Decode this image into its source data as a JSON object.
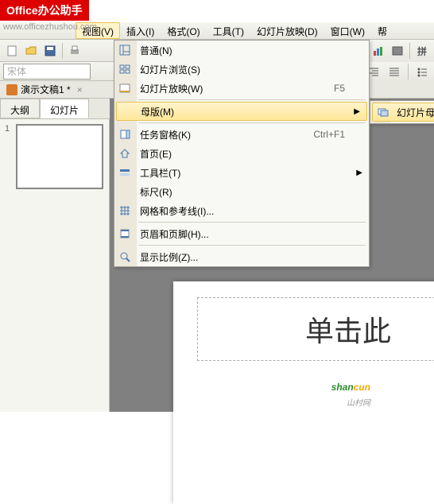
{
  "watermark": {
    "badge": "Office办公助手",
    "url": "www.officezhushou.com",
    "br_shan": "shan",
    "br_cun": "cun",
    "br_sub": "山村网"
  },
  "menubar": {
    "view": "视图(V)",
    "insert": "插入(I)",
    "format": "格式(O)",
    "tools": "工具(T)",
    "slideshow": "幻灯片放映(D)",
    "window": "窗口(W)",
    "help": "帮"
  },
  "toolbar": {
    "font_name": "宋体"
  },
  "doctab": {
    "name": "演示文稿1 *"
  },
  "viewtabs": {
    "outline": "大纲",
    "slides": "幻灯片"
  },
  "thumbnail": {
    "num": "1"
  },
  "dropdown": {
    "normal": "普通(N)",
    "browse": "幻灯片浏览(S)",
    "play": "幻灯片放映(W)",
    "play_key": "F5",
    "master": "母版(M)",
    "taskpane": "任务窗格(K)",
    "taskpane_key": "Ctrl+F1",
    "home": "首页(E)",
    "toolbar": "工具栏(T)",
    "ruler": "标尺(R)",
    "grid": "网格和参考线(I)...",
    "header": "页眉和页脚(H)...",
    "zoom": "显示比例(Z)..."
  },
  "submenu": {
    "slide_master": "幻灯片母版(S)"
  },
  "slide": {
    "title_placeholder": "单击此"
  }
}
